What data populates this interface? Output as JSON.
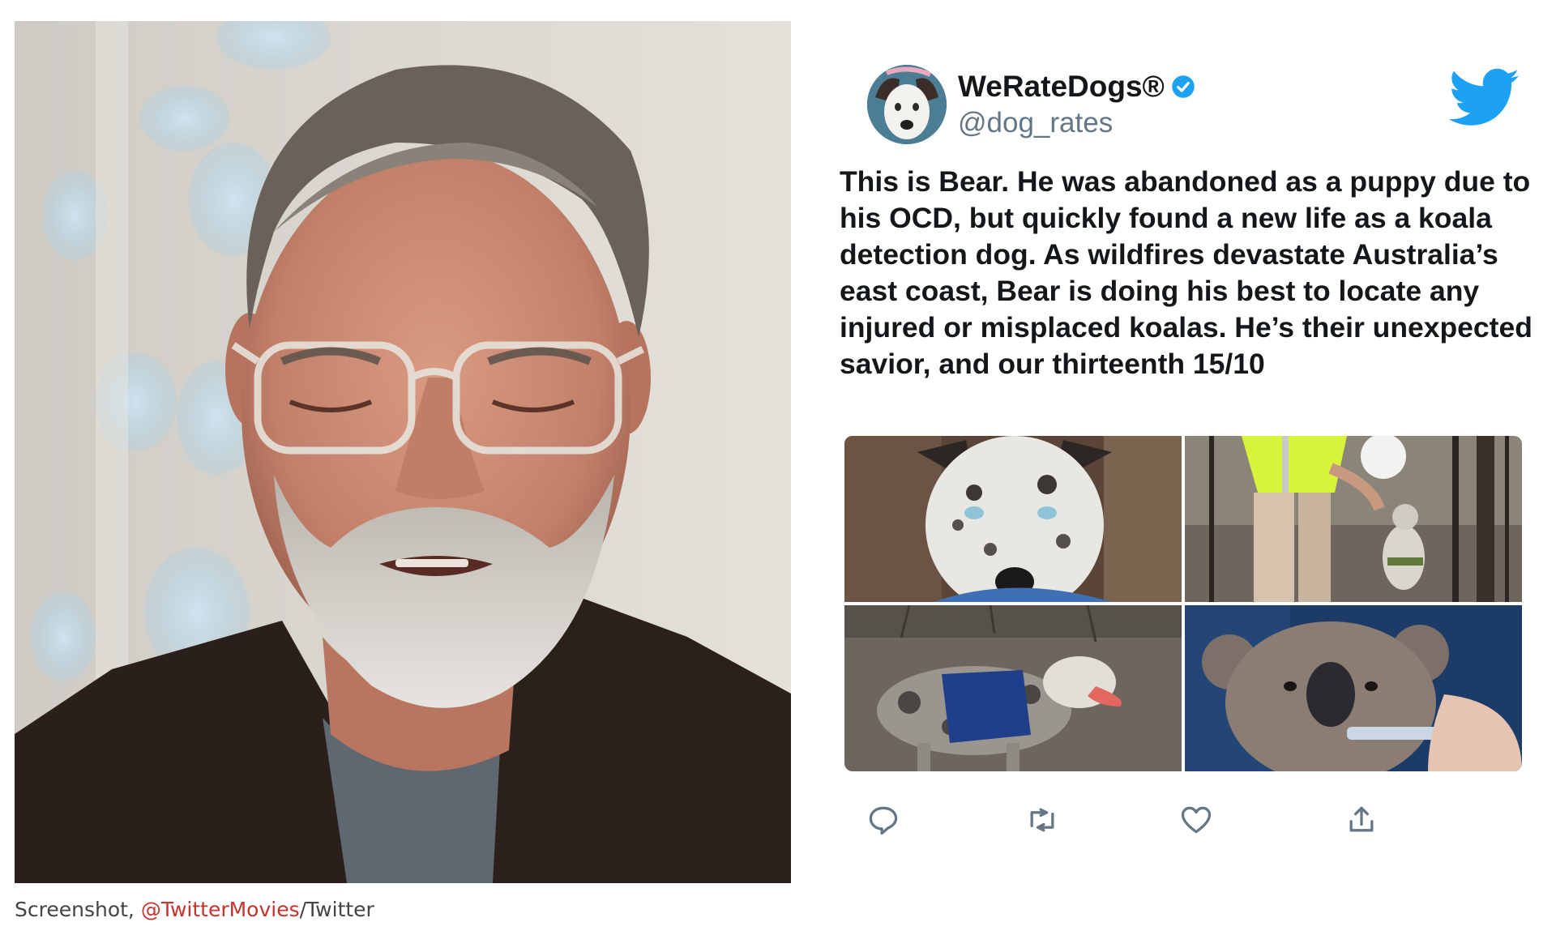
{
  "caption": {
    "prefix": "Screenshot, ",
    "link": "@TwitterMovies",
    "suffix": "/Twitter"
  },
  "tweet": {
    "display_name": "WeRateDogs®",
    "handle": "@dog_rates",
    "verified": true,
    "text": "This is Bear. He was abandoned as a puppy due to his OCD, but quickly found a new life as a koala detection dog. As wildfires devastate Australia’s east coast, Bear is doing his best to locate any injured or misplaced koalas. He’s their unexpected savior, and our thirteenth 15/10",
    "media": [
      {
        "name": "photo-dog-closeup",
        "depicts": "blue-eyed merle dog close-up"
      },
      {
        "name": "photo-handler-with-dog",
        "depicts": "handler in hi-vis vest with dog in burnt forest"
      },
      {
        "name": "photo-dog-in-vest",
        "depicts": "dog wearing blue vest in burnt forest"
      },
      {
        "name": "photo-koala-drinking",
        "depicts": "koala drinking from syringe"
      }
    ],
    "actions": [
      {
        "name": "reply",
        "icon": "reply-icon"
      },
      {
        "name": "retweet",
        "icon": "retweet-icon"
      },
      {
        "name": "like",
        "icon": "heart-icon"
      },
      {
        "name": "share",
        "icon": "share-icon"
      }
    ],
    "colors": {
      "brand_blue": "#1da1f2",
      "text": "#14171a",
      "handle_gray": "#657786",
      "icon_gray": "#657786"
    }
  },
  "colors": {
    "caption_link": "#c8322c",
    "caption_text": "#444444"
  }
}
